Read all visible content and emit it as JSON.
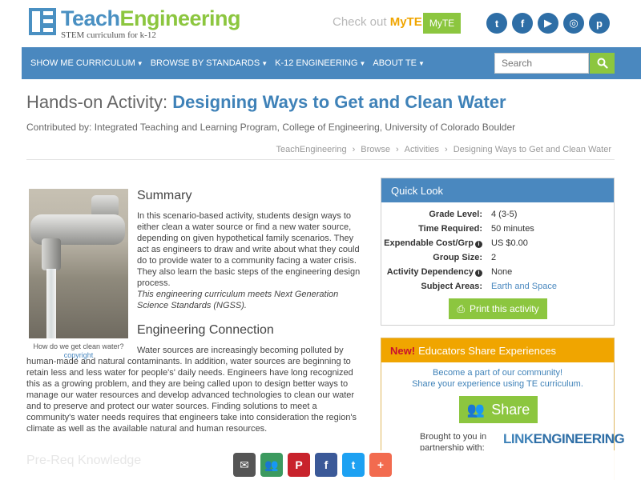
{
  "header": {
    "logo_part1": "Teach",
    "logo_part2": "Engineering",
    "logo_sub": "STEM curriculum for k-12",
    "checkout_prefix": "Check out ",
    "checkout_brand": "MyTE",
    "myte_button": "MyTE",
    "socials": [
      {
        "icon": "twitter-icon",
        "glyph": "t"
      },
      {
        "icon": "facebook-icon",
        "glyph": "f"
      },
      {
        "icon": "youtube-icon",
        "glyph": "▶"
      },
      {
        "icon": "instagram-icon",
        "glyph": "◎"
      },
      {
        "icon": "pinterest-icon",
        "glyph": "p"
      }
    ]
  },
  "nav": {
    "items": [
      "Show Me Curriculum",
      "Browse by Standards",
      "K-12 Engineering",
      "About TE"
    ],
    "search_placeholder": "Search"
  },
  "page": {
    "title_prefix": "Hands-on Activity: ",
    "title_main": "Designing Ways to Get and Clean Water",
    "contributed": "Contributed by: Integrated Teaching and Learning Program, College of Engineering, University of Colorado Boulder",
    "breadcrumb": [
      "TeachEngineering",
      "Browse",
      "Activities",
      "Designing Ways to Get and Clean Water"
    ]
  },
  "image": {
    "caption": "How do we get clean water?",
    "copyright": "copyright"
  },
  "summary": {
    "heading": "Summary",
    "text": "In this scenario-based activity, students design ways to either clean a water source or find a new water source, depending on given hypothetical family scenarios. They act as engineers to draw and write about what they could do to provide water to a community facing a water crisis. They also learn the basic steps of the engineering design process.",
    "ngss": "This engineering curriculum meets Next Generation Science Standards (NGSS)."
  },
  "engineering": {
    "heading": "Engineering Connection",
    "text": "Water sources are increasingly becoming polluted by human-made and natural contaminants. In addition, water sources are beginning to retain less and less water for people's' daily needs. Engineers have long recognized this as a growing problem, and they are being called upon to design better ways to manage our water resources and develop advanced technologies to clean our water and to preserve and protect our water sources. Finding solutions to meet a community's water needs requires that engineers take into consideration the region's climate as well as the available natural and human resources."
  },
  "quick_look": {
    "heading": "Quick Look",
    "rows": [
      {
        "label": "Grade Level:",
        "value": "4 (3-5)"
      },
      {
        "label": "Time Required:",
        "value": "50 minutes"
      },
      {
        "label": "Expendable Cost/Grp",
        "value": "US $0.00"
      },
      {
        "label": "Group Size:",
        "value": "2"
      },
      {
        "label": "Activity Dependency",
        "value": "None"
      },
      {
        "label": "Subject Areas:",
        "value": "Earth and Space"
      }
    ],
    "print_label": "Print this activity"
  },
  "educators": {
    "new_label": "New!",
    "heading": "Educators Share Experiences",
    "line1": "Become a part of our community!",
    "line2": "Share your experience using TE curriculum.",
    "share_label": "Share",
    "brought_line1": "Brought to you in",
    "brought_line2": "partnership with:",
    "partner_part1": "LINK",
    "partner_part2": "ENGINEERING"
  },
  "sharebar": {
    "faded_text": "Pre-Req Knowledge",
    "icons": [
      {
        "icon": "email-icon",
        "glyph": "✉",
        "color": "#555555"
      },
      {
        "icon": "group-share-icon",
        "glyph": "👥",
        "color": "#3c9a5f"
      },
      {
        "icon": "pinterest-icon",
        "glyph": "P",
        "color": "#c8232c"
      },
      {
        "icon": "facebook-icon",
        "glyph": "f",
        "color": "#3b5998"
      },
      {
        "icon": "twitter-icon",
        "glyph": "t",
        "color": "#1da1f2"
      },
      {
        "icon": "more-plus-icon",
        "glyph": "+",
        "color": "#f26b4f"
      }
    ]
  },
  "colors": {
    "brand_blue": "#4a88bf",
    "brand_green": "#8cc63f",
    "accent_orange": "#f0a500"
  }
}
